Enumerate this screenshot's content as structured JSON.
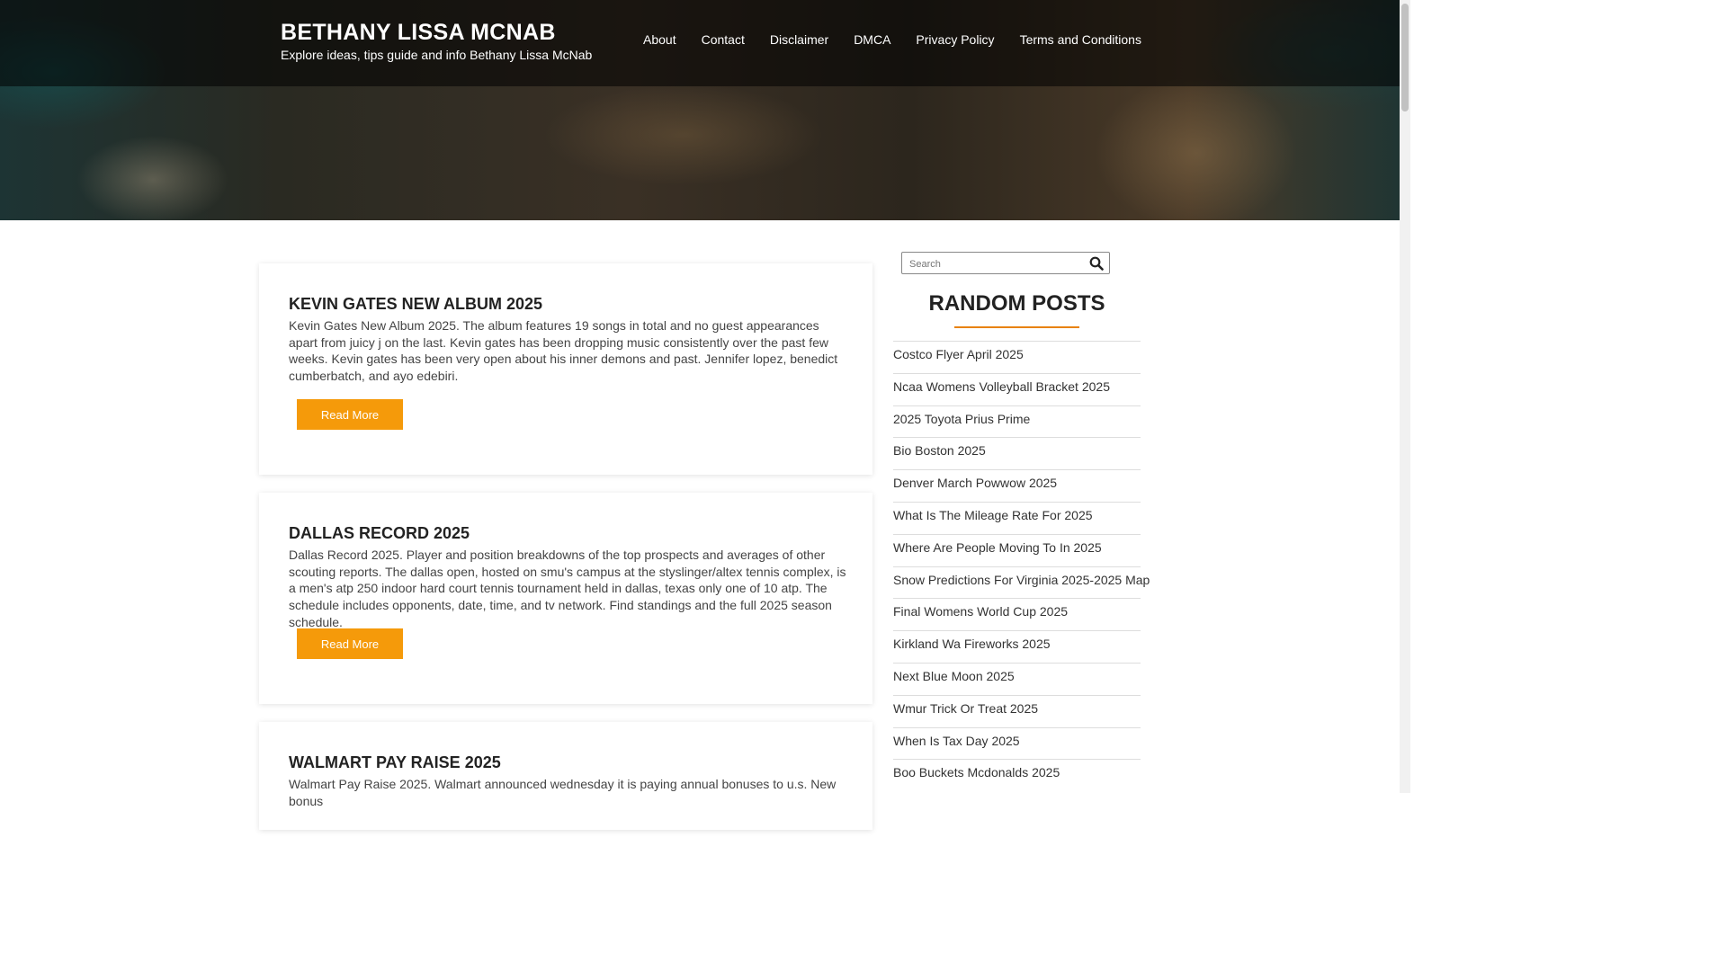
{
  "header": {
    "site_title": "BETHANY LISSA MCNAB",
    "tagline": "Explore ideas, tips guide and info Bethany Lissa McNab"
  },
  "nav": {
    "items": [
      {
        "label": "About"
      },
      {
        "label": "Contact"
      },
      {
        "label": "Disclaimer"
      },
      {
        "label": "DMCA"
      },
      {
        "label": "Privacy Policy"
      },
      {
        "label": "Terms and Conditions"
      }
    ]
  },
  "posts": [
    {
      "title": "KEVIN GATES NEW ALBUM 2025",
      "excerpt": "Kevin Gates New Album 2025. The album features 19 songs in total and no guest appearances apart from juicy j on the last. Kevin gates has been dropping music consistently over the past few weeks. Kevin gates has been very open about his inner demons and past. Jennifer lopez, benedict cumberbatch, and ayo edebiri.",
      "button": "Read More"
    },
    {
      "title": "DALLAS RECORD 2025",
      "excerpt": "Dallas Record 2025. Player and position breakdowns of the top prospects and averages of other scouting reports. The dallas open, hosted on smu's campus at the styslinger/altex tennis complex, is a men's atp 250 indoor hard court tennis tournament held in dallas, texas only one of 10 atp. The schedule includes opponents, date, time, and tv network. Find standings and the full 2025 season schedule.",
      "button": "Read More"
    },
    {
      "title": "WALMART PAY RAISE 2025",
      "excerpt": "Walmart Pay Raise 2025. Walmart announced wednesday it is paying annual bonuses to u.s. New bonus"
    }
  ],
  "sidebar": {
    "search_placeholder": "Search",
    "search_icon": "magnifier",
    "random_title": "RANDOM POSTS",
    "accent_color": "#e8820c",
    "random_posts": [
      "Costco Flyer April 2025",
      "Ncaa Womens Volleyball Bracket 2025",
      "2025 Toyota Prius Prime",
      "Bio Boston 2025",
      "Denver March Powwow 2025",
      "What Is The Mileage Rate For 2025",
      "Where Are People Moving To In 2025",
      "Snow Predictions For Virginia 2025-2025 Map",
      "Final Womens World Cup 2025",
      "Kirkland Wa Fireworks 2025",
      "Next Blue Moon 2025",
      "Wmur Trick Or Treat 2025",
      "When Is Tax Day 2025",
      "Boo Buckets Mcdonalds 2025"
    ]
  },
  "colors": {
    "button": "#f59a0a",
    "header_overlay": "#000000"
  }
}
